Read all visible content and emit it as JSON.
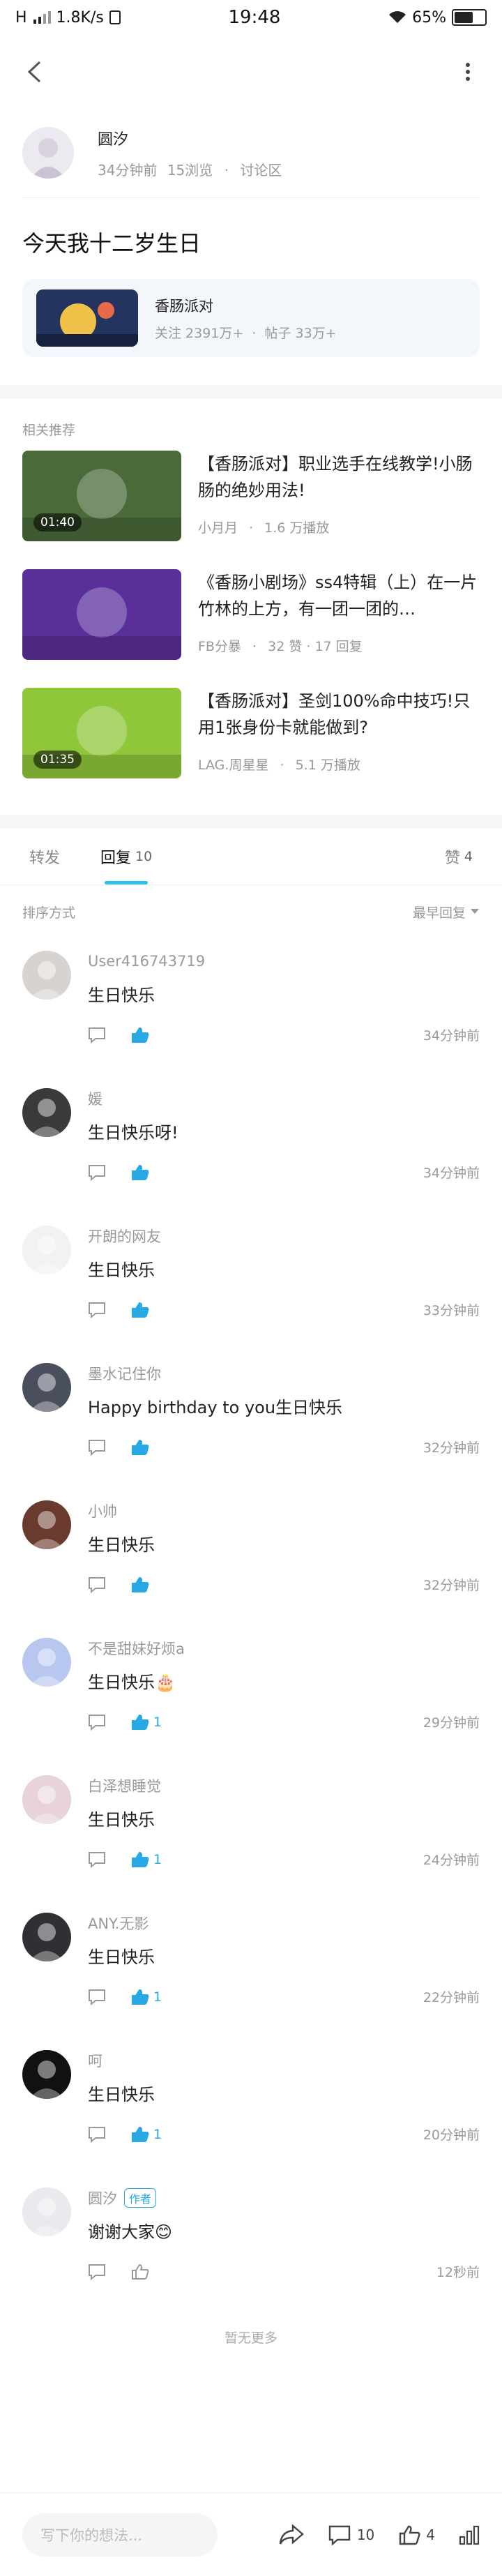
{
  "status": {
    "carrier": "H",
    "speed": "1.8K/s",
    "time": "19:48",
    "battery": "65%",
    "battery_level": 0.65
  },
  "topbar": {
    "back_icon": "back-icon",
    "more_icon": "more-icon"
  },
  "author": {
    "name": "圆汐",
    "time": "34分钟前",
    "views": "15浏览",
    "board": "讨论区"
  },
  "post": {
    "title": "今天我十二岁生日"
  },
  "forum": {
    "name": "香肠派对",
    "followers": "关注 2391万+",
    "posts": "帖子 33万+"
  },
  "related": {
    "label": "相关推荐",
    "items": [
      {
        "title": "【香肠派对】职业选手在线教学!小肠肠的绝妙用法!",
        "author": "小月月",
        "stats": "1.6 万播放",
        "duration": "01:40",
        "thumb_color": "#4b6a3a"
      },
      {
        "title": "《香肠小剧场》ss4特辑（上）在一片竹林的上方，有一团一团的…",
        "author": "FB分暴",
        "stats": "32 赞 · 17 回复",
        "duration": "",
        "thumb_color": "#5a2f9a"
      },
      {
        "title": "【香肠派对】圣剑100%命中技巧!只用1张身份卡就能做到?",
        "author": "LAG.周星星",
        "stats": "5.1 万播放",
        "duration": "01:35",
        "thumb_color": "#8fc63a"
      }
    ]
  },
  "tabs": {
    "forward": "转发",
    "reply": "回复",
    "reply_count": "10",
    "like": "赞",
    "like_count": "4"
  },
  "sort": {
    "label": "排序方式",
    "value": "最早回复"
  },
  "comments": [
    {
      "name": "User416743719",
      "text": "生日快乐",
      "likes": "",
      "time": "34分钟前",
      "author_tag": ""
    },
    {
      "name": "媛",
      "text": "生日快乐呀!",
      "likes": "",
      "time": "34分钟前",
      "author_tag": ""
    },
    {
      "name": "开朗的网友",
      "text": "生日快乐",
      "likes": "",
      "time": "33分钟前",
      "author_tag": ""
    },
    {
      "name": "墨水记住你",
      "text": "Happy birthday to you生日快乐",
      "likes": "",
      "time": "32分钟前",
      "author_tag": ""
    },
    {
      "name": "小帅",
      "text": "生日快乐",
      "likes": "",
      "time": "32分钟前",
      "author_tag": ""
    },
    {
      "name": "不是甜妹好烦a",
      "text": "生日快乐🎂",
      "likes": "1",
      "time": "29分钟前",
      "author_tag": ""
    },
    {
      "name": "白泽想睡觉",
      "text": "生日快乐",
      "likes": "1",
      "time": "24分钟前",
      "author_tag": ""
    },
    {
      "name": "ANY.无影",
      "text": "生日快乐",
      "likes": "1",
      "time": "22分钟前",
      "author_tag": ""
    },
    {
      "name": "呵",
      "text": "生日快乐",
      "likes": "1",
      "time": "20分钟前",
      "author_tag": ""
    },
    {
      "name": "圆汐",
      "text": "谢谢大家😊",
      "likes": "",
      "time": "12秒前",
      "author_tag": "作者"
    }
  ],
  "no_more": "暂无更多",
  "bottom": {
    "placeholder": "写下你的想法...",
    "comments": "10",
    "likes": "4"
  },
  "colors": {
    "accent": "#27c2e6",
    "like_blue": "#27a9e6"
  }
}
